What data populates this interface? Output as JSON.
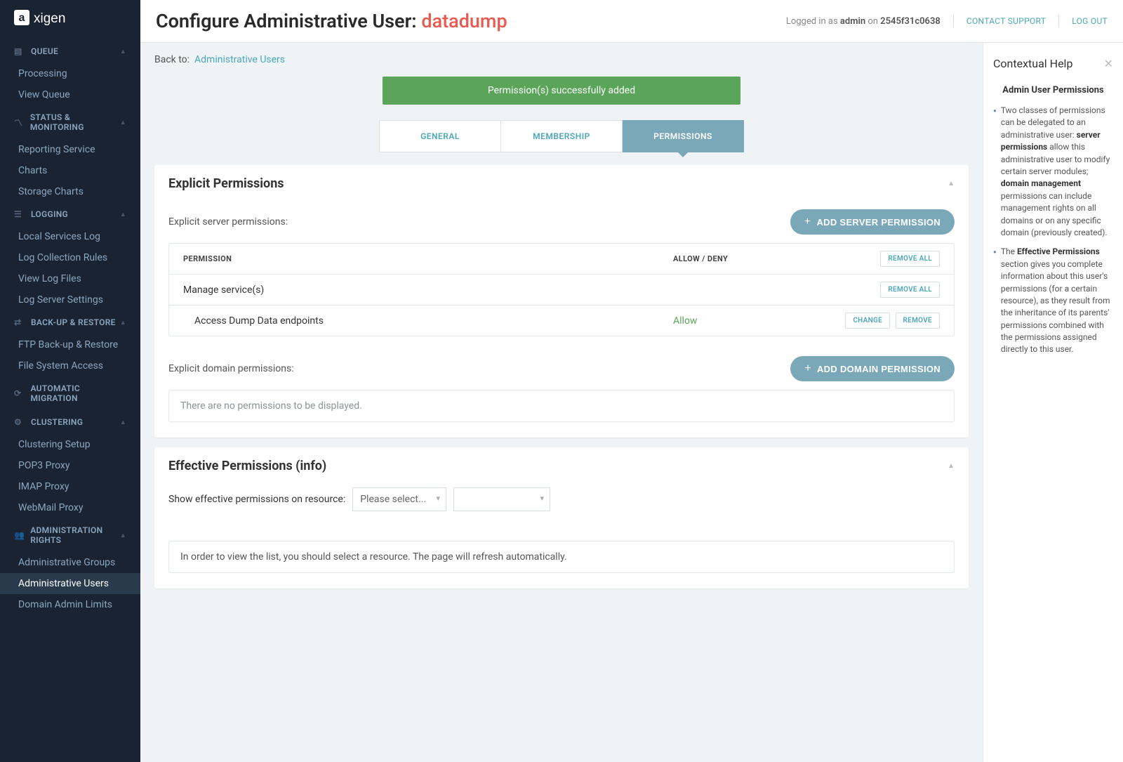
{
  "brand": "axigen",
  "topbar": {
    "logged_in_prefix": "Logged in as ",
    "user": "admin",
    "on": " on ",
    "host": "2545f31c0638",
    "contact": "CONTACT SUPPORT",
    "logout": "LOG OUT"
  },
  "title_prefix": "Configure Administrative User: ",
  "title_accent": "datadump",
  "back_label": "Back to:",
  "back_link": "Administrative Users",
  "alert": "Permission(s) successfully added",
  "tabs": {
    "general": "GENERAL",
    "membership": "MEMBERSHIP",
    "permissions": "PERMISSIONS"
  },
  "explicit": {
    "title": "Explicit Permissions",
    "server_label": "Explicit server permissions:",
    "add_server": "ADD SERVER PERMISSION",
    "col_perm": "PERMISSION",
    "col_ad": "ALLOW / DENY",
    "remove_all": "REMOVE ALL",
    "row_group": "Manage service(s)",
    "row_child": "Access Dump Data endpoints",
    "row_child_status": "Allow",
    "change": "CHANGE",
    "remove": "REMOVE",
    "domain_label": "Explicit domain permissions:",
    "add_domain": "ADD DOMAIN PERMISSION",
    "domain_empty": "There are no permissions to be displayed."
  },
  "effective": {
    "title": "Effective Permissions (info)",
    "show_label": "Show effective permissions on resource:",
    "placeholder": "Please select...",
    "info": "In order to view the list, you should select a resource. The page will refresh automatically."
  },
  "sidebar": {
    "queue": {
      "title": "QUEUE",
      "items": [
        "Processing",
        "View Queue"
      ]
    },
    "status": {
      "title": "STATUS & MONITORING",
      "items": [
        "Reporting Service",
        "Charts",
        "Storage Charts"
      ]
    },
    "logging": {
      "title": "LOGGING",
      "items": [
        "Local Services Log",
        "Log Collection Rules",
        "View Log Files",
        "Log Server Settings"
      ]
    },
    "backup": {
      "title": "BACK-UP & RESTORE",
      "items": [
        "FTP Back-up & Restore",
        "File System Access"
      ]
    },
    "migration": {
      "title": "AUTOMATIC MIGRATION"
    },
    "cluster": {
      "title": "CLUSTERING",
      "items": [
        "Clustering Setup",
        "POP3 Proxy",
        "IMAP Proxy",
        "WebMail Proxy"
      ]
    },
    "admin": {
      "title": "ADMINISTRATION RIGHTS",
      "items": [
        "Administrative Groups",
        "Administrative Users",
        "Domain Admin Limits"
      ]
    }
  },
  "help": {
    "title": "Contextual Help",
    "heading": "Admin User Permissions",
    "p1a": "Two classes of permissions can be delegated to an administrative user: ",
    "p1b": "server permissions",
    "p1c": " allow this administrative user to modify certain server modules; ",
    "p1d": "domain management",
    "p1e": " permissions can include management rights on all domains or on any specific domain (previously created).",
    "p2a": "The ",
    "p2b": "Effective Permissions",
    "p2c": " section gives you complete information about this user's permissions (for a certain resource), as they result from the inheritance of its parents' permissions combined with the permissions assigned directly to this user."
  }
}
